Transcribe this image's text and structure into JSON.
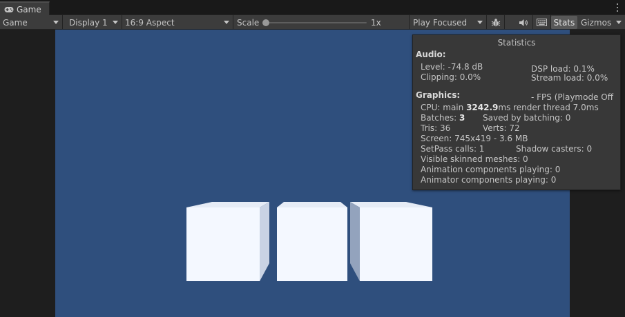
{
  "tab": {
    "title": "Game",
    "icon": "gamepad-icon"
  },
  "toolbar": {
    "view_mode": "Game",
    "display": "Display 1",
    "aspect": "16:9 Aspect",
    "scale_label": "Scale",
    "scale_value": "1x",
    "scale_fraction": 0.0,
    "play_mode": "Play Focused",
    "stats_label": "Stats",
    "gizmos_label": "Gizmos"
  },
  "stats": {
    "title": "Statistics",
    "audio_header": "Audio:",
    "level": "Level: -74.8 dB",
    "clipping": "Clipping: 0.0%",
    "dsp_load": "DSP load: 0.1%",
    "stream_load": "Stream load: 0.0%",
    "graphics_header": "Graphics:",
    "fps": "- FPS (Playmode Off",
    "cpu_prefix": "CPU: main ",
    "cpu_main": "3242.9",
    "cpu_suffix": "ms  render thread 7.0ms",
    "batches_prefix": "Batches: ",
    "batches_value": "3",
    "saved_by_batching": "Saved by batching: 0",
    "tris": "Tris: 36",
    "verts": "Verts: 72",
    "screen": "Screen: 745x419 - 3.6 MB",
    "setpass": "SetPass calls: 1",
    "shadow_casters": "Shadow casters: 0",
    "skinned_meshes": "Visible skinned meshes: 0",
    "animation_components": "Animation components playing: 0",
    "animator_components": "Animator components playing: 0"
  },
  "colors": {
    "game_background": "#2f4f7d",
    "cube_face": "#f4f8ff",
    "panel": "#383838",
    "toolbar": "#3c3c3c"
  }
}
